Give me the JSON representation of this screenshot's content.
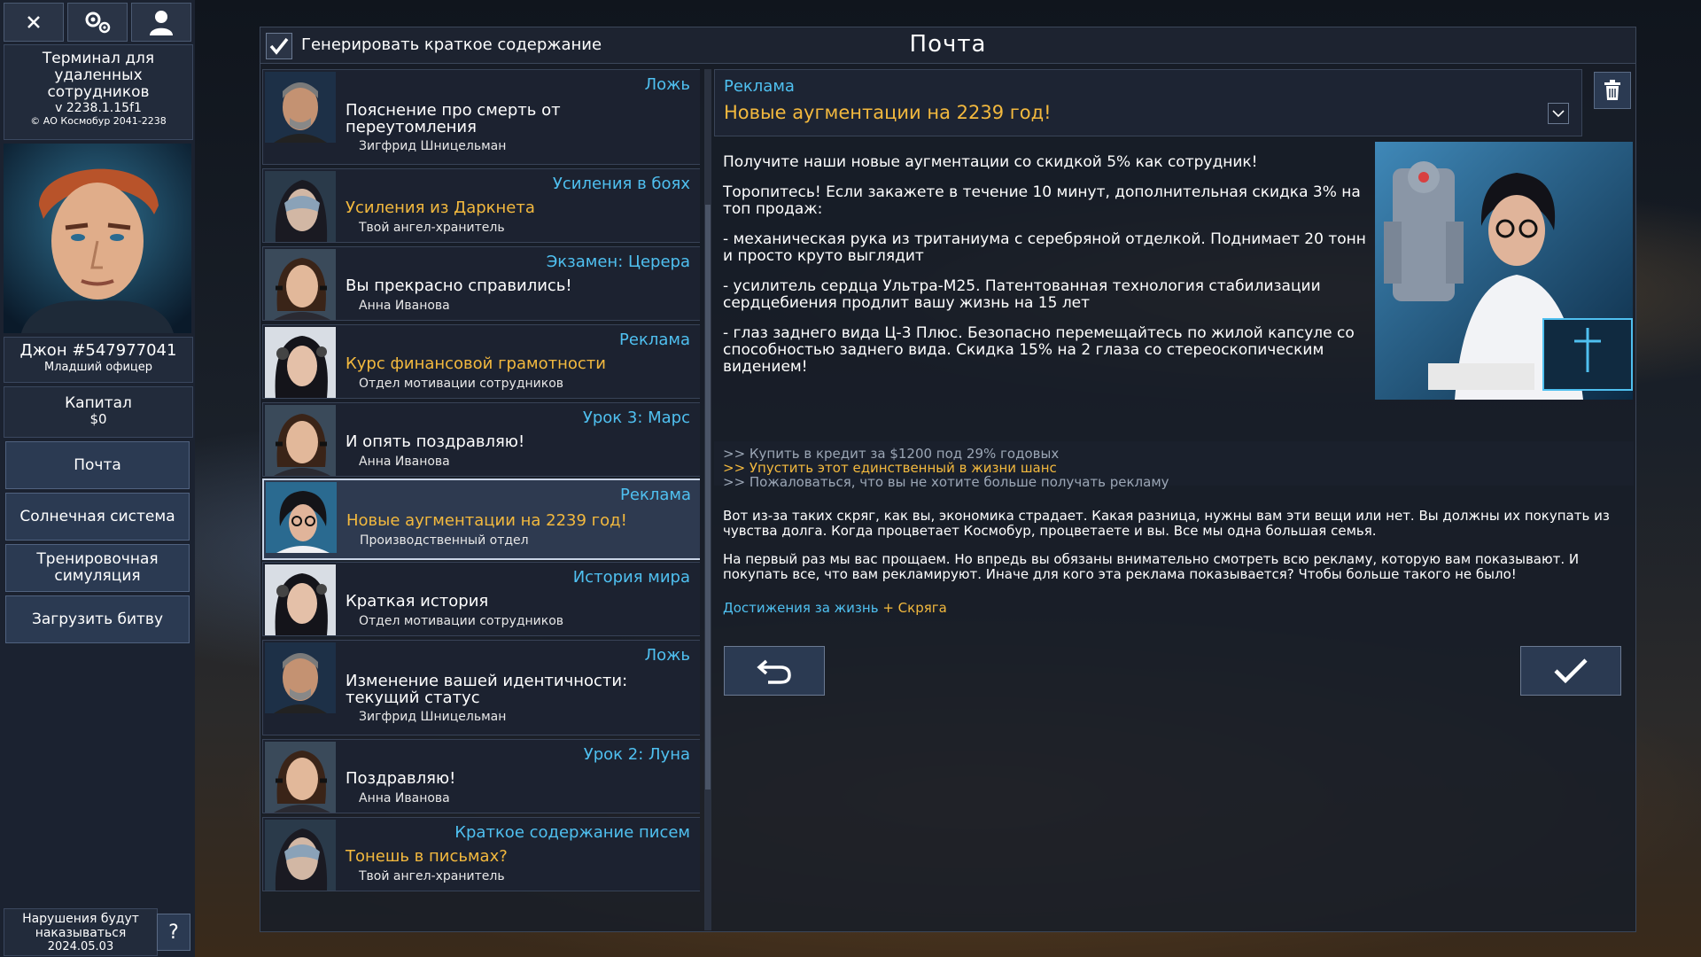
{
  "sidebar": {
    "close_icon": "close-icon",
    "settings_icon": "gears-icon",
    "profile_icon": "user-icon",
    "terminal": {
      "line1": "Терминал для удаленных сотрудников",
      "version": "v 2238.1.15f1",
      "copyright": "© АО Космобур 2041-2238"
    },
    "user": {
      "name": "Джон #547977041",
      "rank": "Младший офицер"
    },
    "capital": {
      "label": "Капитал",
      "value": "$0"
    },
    "nav": [
      {
        "label": "Почта"
      },
      {
        "label": "Солнечная система"
      },
      {
        "label": "Тренировочная симуляция"
      },
      {
        "label": "Загрузить битву"
      }
    ],
    "footer": {
      "text": "Нарушения будут наказываться",
      "date": "2024.05.03"
    },
    "help_label": "?"
  },
  "header": {
    "summary_label": "Генерировать краткое содержание",
    "title": "Почта"
  },
  "mails": [
    {
      "category": "Ложь",
      "subject": "Пояснение про смерть от переутомления",
      "sender": "Зигфрид Шницельман"
    },
    {
      "category": "Усиления в боях",
      "subject": "Усиления из Даркнета",
      "sender": "Твой ангел-хранитель"
    },
    {
      "category": "Экзамен: Церера",
      "subject": "Вы прекрасно справились!",
      "sender": "Анна Иванова"
    },
    {
      "category": "Реклама",
      "subject": "Курс финансовой грамотности",
      "sender": "Отдел мотивации сотрудников"
    },
    {
      "category": "Урок 3: Марс",
      "subject": "И опять поздравляю!",
      "sender": "Анна Иванова"
    },
    {
      "category": "Реклама",
      "subject": "Новые аугментации на 2239 год!",
      "sender": "Производственный отдел"
    },
    {
      "category": "История мира",
      "subject": "Краткая история",
      "sender": "Отдел мотивации сотрудников"
    },
    {
      "category": "Ложь",
      "subject": "Изменение вашей идентичности: текущий статус",
      "sender": "Зигфрид Шницельман"
    },
    {
      "category": "Урок 2: Луна",
      "subject": "Поздравляю!",
      "sender": "Анна Иванова"
    },
    {
      "category": "Краткое содержание писем",
      "subject": "Тонешь в письмах?",
      "sender": "Твой ангел-хранитель"
    }
  ],
  "reader": {
    "category": "Реклама",
    "subject": "Новые аугментации на 2239 год!",
    "paragraphs": [
      "Получите наши новые аугментации со скидкой 5% как сотрудник!",
      "Торопитесь! Если закажете в течение 10 минут, дополнительная скидка 3% на топ продаж:",
      "- механическая рука из тританиума с серебряной отделкой. Поднимает 20 тонн и просто круто выглядит",
      "- усилитель сердца Ультра-М25. Патентованная технология стабилизации сердцебиения продлит вашу жизнь на 15 лет",
      "- глаз заднего вида Ц-3 Плюс. Безопасно перемещайтесь по жилой капсуле со способностью заднего вида. Скидка 15% на 2 глаза со стереоскопическим видением!"
    ],
    "options": [
      ">> Купить в кредит за $1200 под 29% годовых",
      ">> Упустить этот единственный в жизни шанс",
      ">> Пожаловаться, что вы не хотите больше получать рекламу"
    ],
    "reply_paragraphs": [
      "Вот из-за таких скряг, как вы, экономика страдает. Какая разница, нужны вам эти вещи или нет. Вы должны их покупать из чувства долга. Когда процветает Космобур, процветаете и вы. Все мы одна большая семья.",
      "На первый раз мы вас прощаем. Но впредь вы обязаны внимательно смотреть всю рекламу, которую вам показывают. И покупать все, что вам рекламируют. Иначе для кого эта реклама показывается? Чтобы больше такого не было!"
    ],
    "achievement": {
      "label": "Достижения за жизнь",
      "value": "+ Скряга"
    }
  },
  "colors": {
    "accent_blue": "#4fc0f0",
    "highlight_orange": "#f3b93e"
  }
}
